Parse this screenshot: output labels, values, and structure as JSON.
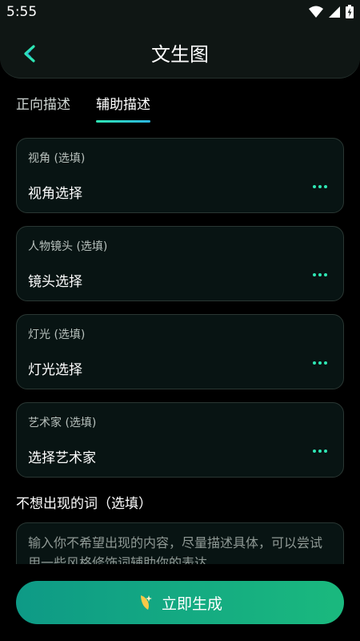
{
  "status_bar": {
    "time": "5:55"
  },
  "header": {
    "title": "文生图",
    "back_icon": "chevron-left-icon"
  },
  "tabs": [
    {
      "label": "正向描述",
      "active": false
    },
    {
      "label": "辅助描述",
      "active": true
    }
  ],
  "options": [
    {
      "label": "视角 (选填)",
      "value": "视角选择"
    },
    {
      "label": "人物镜头 (选填)",
      "value": "镜头选择"
    },
    {
      "label": "灯光 (选填)",
      "value": "灯光选择"
    },
    {
      "label": "艺术家 (选填)",
      "value": "选择艺术家"
    }
  ],
  "negative": {
    "title": "不想出现的词（选填）",
    "placeholder": "输入你不希望出现的内容，尽量描述具体，可以尝试用一些风格修饰词辅助你的表达"
  },
  "action": {
    "generate_label": "立即生成",
    "generate_icon": "sparkle-icon"
  },
  "colors": {
    "accent": "#2ee6b4",
    "button_start": "#0e9a86",
    "button_end": "#1ab97e"
  }
}
